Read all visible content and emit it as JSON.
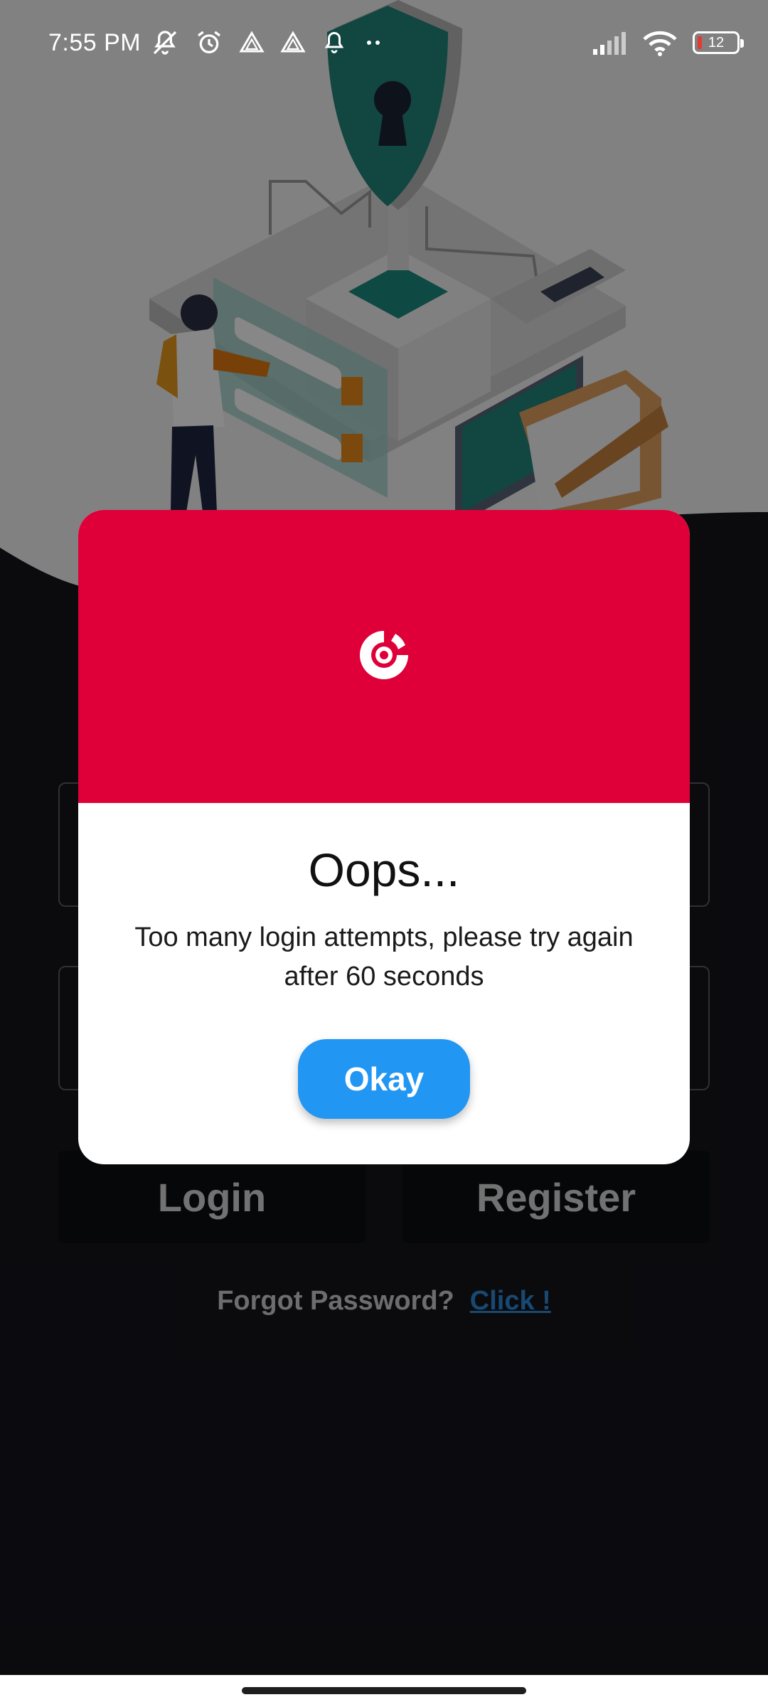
{
  "status_bar": {
    "time": "7:55 PM",
    "left_icons": [
      "mute-icon",
      "alarm-icon",
      "drive-icon",
      "drive-icon",
      "notification-bell-icon",
      "more-dots-icon"
    ],
    "right_icons": [
      "signal-icon",
      "wifi-icon",
      "battery-icon"
    ],
    "battery_level": "12"
  },
  "background": {
    "hero_illustration": "security-shield-illustration",
    "buttons": {
      "login_label": "Login",
      "register_label": "Register"
    },
    "forgot": {
      "label": "Forgot Password?",
      "link": "Click !"
    }
  },
  "dialog": {
    "header_color": "#df003a",
    "icon": "app-logo-icon",
    "title": "Oops...",
    "message": "Too many login attempts, please try again after 60 seconds",
    "ok_label": "Okay",
    "ok_color": "#2196f3"
  }
}
